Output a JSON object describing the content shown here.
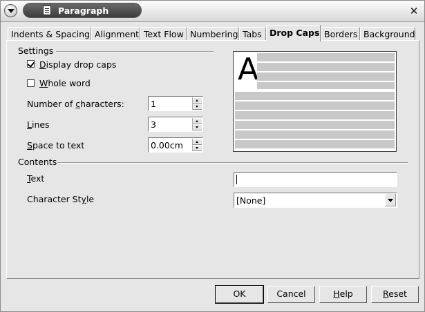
{
  "window": {
    "title": "Paragraph"
  },
  "tabs": [
    {
      "label": "Indents & Spacing"
    },
    {
      "label": "Alignment"
    },
    {
      "label": "Text Flow"
    },
    {
      "label": "Numbering"
    },
    {
      "label": "Tabs"
    },
    {
      "label": "Drop Caps",
      "active": true
    },
    {
      "label": "Borders"
    },
    {
      "label": "Background"
    }
  ],
  "settings": {
    "heading": "Settings",
    "display_drop_caps": {
      "label_accel": "D",
      "label_rest": "isplay drop caps",
      "checked": true
    },
    "whole_word": {
      "label_accel": "W",
      "label_rest": "hole word",
      "checked": false
    },
    "number_of_characters": {
      "label_pre": "Number of ",
      "label_accel": "c",
      "label_rest": "haracters:",
      "value": "1"
    },
    "lines": {
      "label_accel": "L",
      "label_rest": "ines",
      "value": "3"
    },
    "space_to_text": {
      "label_accel": "S",
      "label_rest": "pace to text",
      "value": "0.00cm"
    }
  },
  "preview": {
    "drop_letter": "A"
  },
  "contents": {
    "heading": "Contents",
    "text": {
      "label_accel": "T",
      "label_rest": "ext",
      "value": ""
    },
    "character_style": {
      "label_pre": "Character St",
      "label_accel": "y",
      "label_rest": "le",
      "value": "[None]"
    }
  },
  "buttons": {
    "ok": "OK",
    "cancel": "Cancel",
    "help_accel": "H",
    "help_rest": "elp",
    "reset_accel": "R",
    "reset_rest": "eset"
  }
}
